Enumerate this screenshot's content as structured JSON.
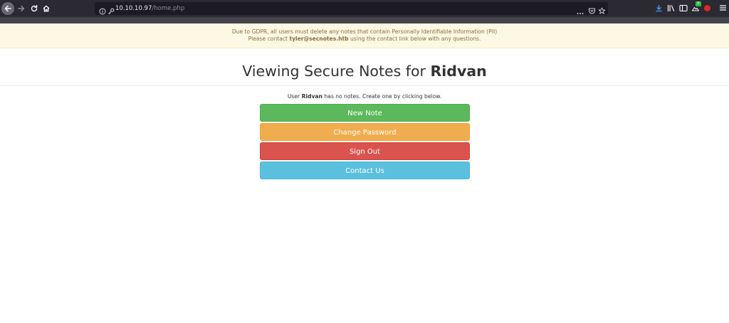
{
  "browser": {
    "url_host": "10.10.10.97",
    "url_path": "/home.php",
    "extension_badge": "0"
  },
  "banner": {
    "line1": "Due to GDPR, all users must delete any notes that contain Personally Identifiable Information (PII)",
    "line2_prefix": "Please contact ",
    "line2_email": "tyler@secnotes.htb",
    "line2_suffix": " using the contact link below with any questions."
  },
  "header": {
    "title_prefix": "Viewing Secure Notes for ",
    "username": "Ridvan"
  },
  "notes": {
    "msg_prefix": "User ",
    "username": "Ridvan",
    "msg_suffix": " has no notes. Create one by clicking below."
  },
  "buttons": {
    "new_note": "New Note",
    "change_password": "Change Password",
    "sign_out": "Sign Out",
    "contact_us": "Contact Us"
  },
  "colors": {
    "success": "#5cb85c",
    "warning": "#f0ad4e",
    "danger": "#d9534f",
    "info": "#5bc0de",
    "banner_bg": "#fcf8e3",
    "banner_text": "#8a6d3b"
  }
}
